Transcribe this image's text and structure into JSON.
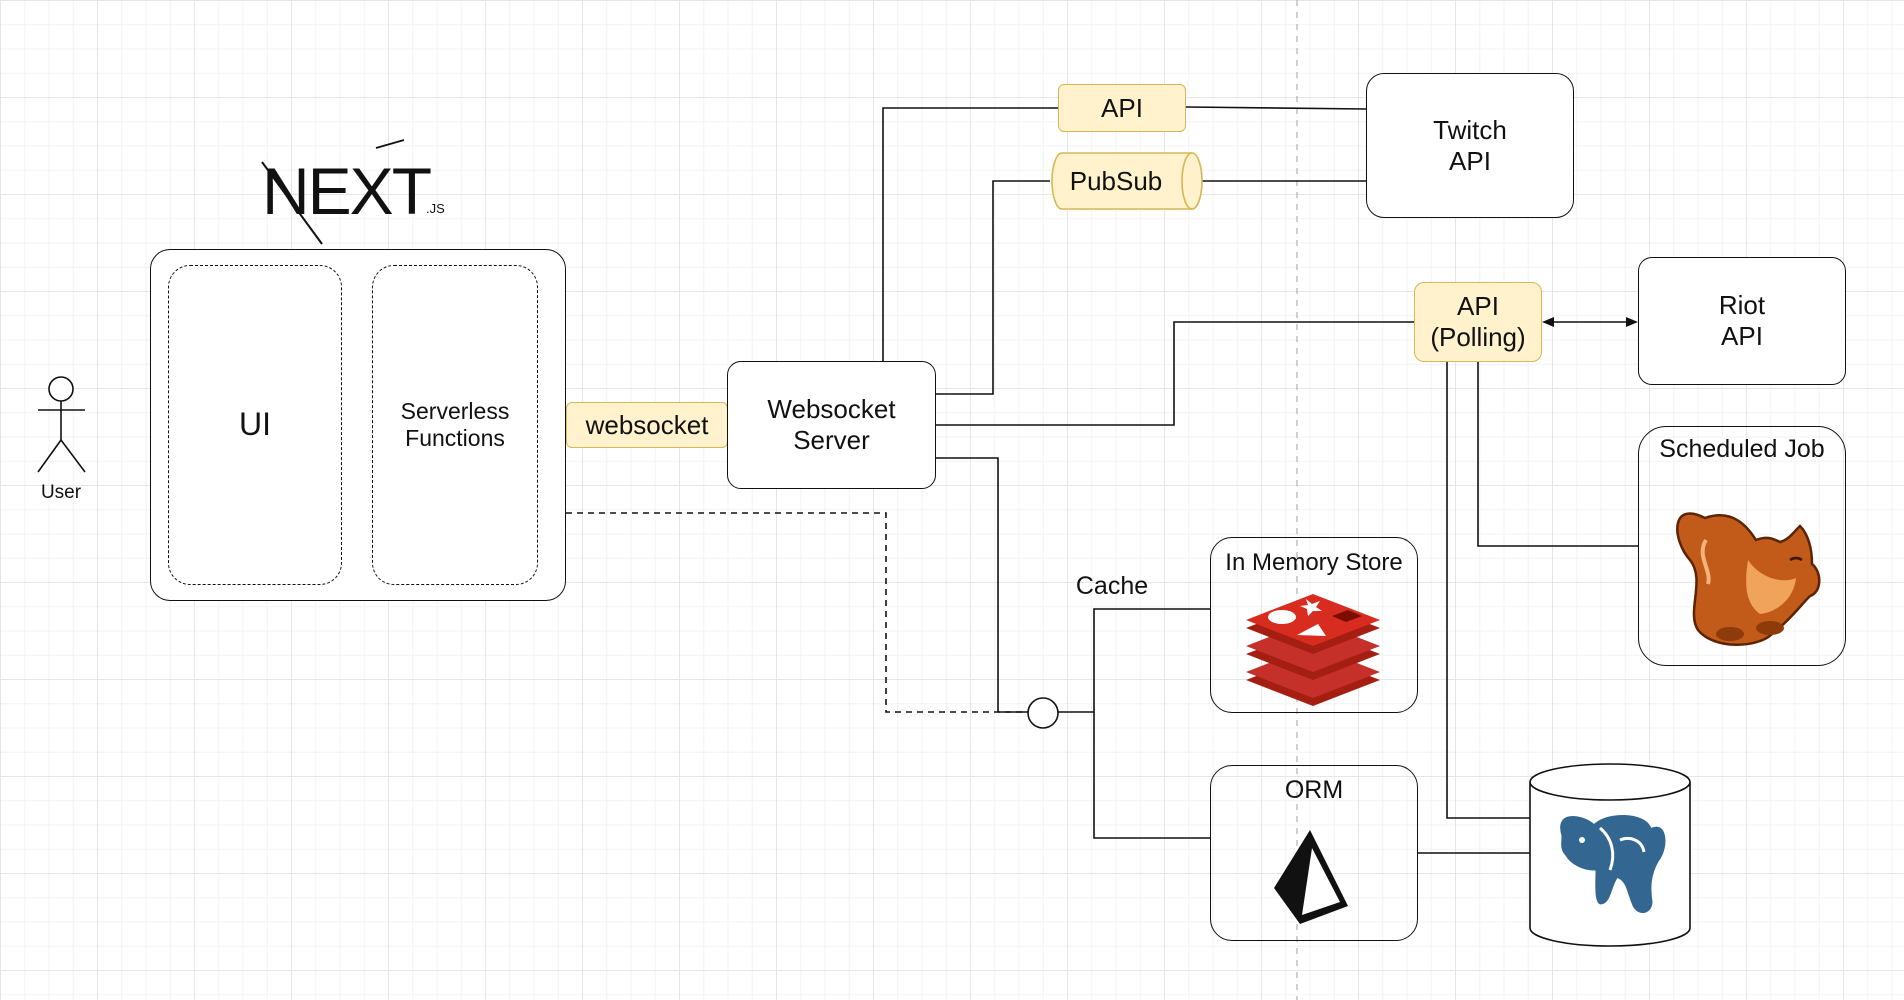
{
  "diagram": {
    "user_label": "User",
    "nextjs_logo_text": "NEXT",
    "nextjs_logo_suffix": ".JS",
    "ui_label": "UI",
    "serverless_label": "Serverless\nFunctions",
    "websocket_tag": "websocket",
    "websocket_server_label": "Websocket\nServer",
    "api_tag": "API",
    "pubsub_tag": "PubSub",
    "twitch_label": "Twitch\nAPI",
    "api_polling_tag": "API\n(Polling)",
    "riot_label": "Riot\nAPI",
    "scheduled_job_label": "Scheduled Job",
    "cache_label": "Cache",
    "in_memory_store_label": "In Memory Store",
    "orm_label": "ORM"
  },
  "colors": {
    "tag_fill": "#fff2cc",
    "tag_border": "#d6b656",
    "line": "#111111",
    "redis_red": "#c6302b",
    "postgres_blue": "#336791",
    "squirrel_orange": "#c25a1a"
  },
  "icons": {
    "user": "stick-figure-icon",
    "cache_store": "redis-icon",
    "orm": "prisma-icon",
    "database": "postgresql-elephant-icon",
    "scheduler": "squirrel-icon"
  }
}
